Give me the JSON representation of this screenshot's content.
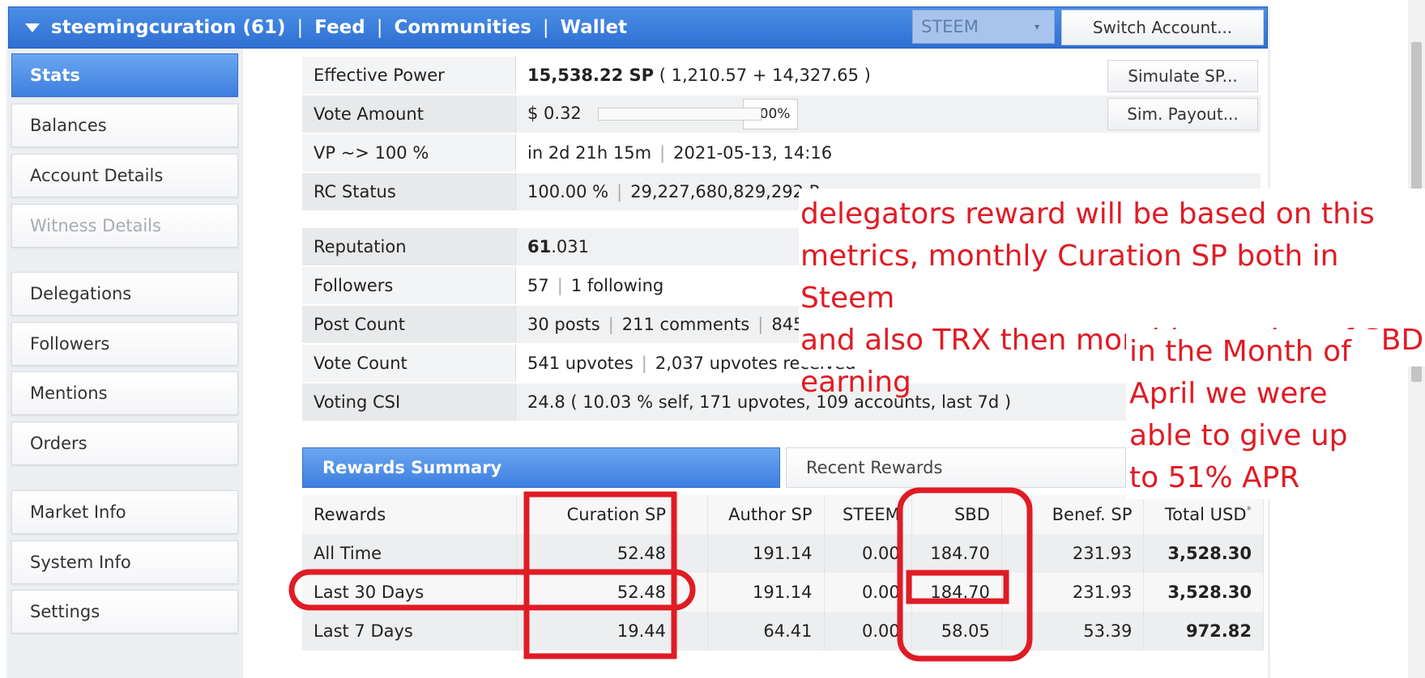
{
  "header": {
    "account": "steemingcuration (61)",
    "nav": [
      "Feed",
      "Communities",
      "Wallet"
    ],
    "separator": "|",
    "chain_select": "STEEM",
    "switch_button": "Switch Account..."
  },
  "sidebar": {
    "items": [
      {
        "label": "Stats",
        "state": "active"
      },
      {
        "label": "Balances"
      },
      {
        "label": "Account Details"
      },
      {
        "label": "Witness Details",
        "state": "disabled"
      },
      {
        "label": "Delegations"
      },
      {
        "label": "Followers"
      },
      {
        "label": "Mentions"
      },
      {
        "label": "Orders"
      },
      {
        "label": "Market Info"
      },
      {
        "label": "System Info"
      },
      {
        "label": "Settings"
      }
    ]
  },
  "stats": {
    "effective_power": {
      "label": "Effective Power",
      "value": "15,538.22 SP",
      "detail": "( 1,210.57 + 14,327.65 )",
      "button": "Simulate SP..."
    },
    "vote_amount": {
      "label": "Vote Amount",
      "value": "$ 0.32",
      "percent": "100%",
      "button": "Sim. Payout..."
    },
    "vp": {
      "label": "VP ~> 100 %",
      "eta": "in 2d 21h 15m",
      "date": "2021-05-13, 14:16"
    },
    "rc": {
      "label": "RC Status",
      "percent": "100.00 %",
      "amount": "29,227,680,829,292 R"
    },
    "reputation": {
      "label": "Reputation",
      "whole": "61",
      "fraction": ".031"
    },
    "followers": {
      "label": "Followers",
      "count": "57",
      "following": "1 following"
    },
    "post_count": {
      "label": "Post Count",
      "posts": "30 posts",
      "comments": "211 comments",
      "extra": "845"
    },
    "vote_count": {
      "label": "Vote Count",
      "upvotes": "541 upvotes",
      "received": "2,037 upvotes received"
    },
    "voting_csi": {
      "label": "Voting CSI",
      "value": "24.8 ( 10.03 % self, 171 upvotes, 109 accounts, last 7d )"
    }
  },
  "rewards": {
    "tabs": [
      "Rewards Summary",
      "Recent Rewards"
    ],
    "columns": [
      "Rewards",
      "Curation SP",
      "",
      "Author SP",
      "STEEM",
      "SBD",
      "",
      "Benef. SP",
      "Total USD"
    ],
    "total_footnote": "*",
    "rows": [
      {
        "label": "All Time",
        "curation_sp": "52.48",
        "author_sp": "191.14",
        "steem": "0.00",
        "sbd": "184.70",
        "benef_sp": "231.93",
        "total_usd": "3,528.30"
      },
      {
        "label": "Last 30 Days",
        "curation_sp": "52.48",
        "author_sp": "191.14",
        "steem": "0.00",
        "sbd": "184.70",
        "benef_sp": "231.93",
        "total_usd": "3,528.30"
      },
      {
        "label": "Last 7 Days",
        "curation_sp": "19.44",
        "author_sp": "64.41",
        "steem": "0.00",
        "sbd": "58.05",
        "benef_sp": "53.39",
        "total_usd": "972.82"
      }
    ]
  },
  "annotations": {
    "note1": [
      "delegators reward will be based on this",
      "metrics, monthly Curation SP both in Steem",
      "and also TRX then monthly earning of SBD",
      "earning"
    ],
    "note2": [
      "in the Month of",
      "April we were",
      "able to give up",
      "to 51% APR"
    ],
    "mark_color": "#e01b24"
  }
}
